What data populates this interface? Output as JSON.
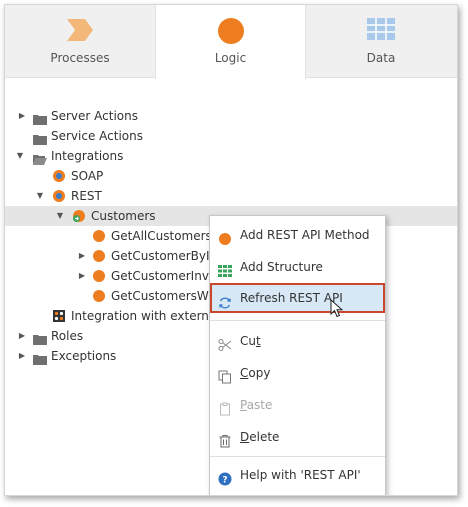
{
  "tabs": [
    {
      "label": "Processes",
      "icon": "processes-chevron-icon"
    },
    {
      "label": "Logic",
      "icon": "logic-circle-icon"
    },
    {
      "label": "Data",
      "icon": "data-grid-icon"
    }
  ],
  "tree": {
    "server_actions": "Server Actions",
    "service_actions": "Service Actions",
    "integrations": "Integrations",
    "soap": "SOAP",
    "rest": "REST",
    "customers": "Customers",
    "method1": "GetAllCustomers",
    "method2": "GetCustomerByI",
    "method3": "GetCustomerInv",
    "method4": "GetCustomersWi",
    "integration_external": "Integration with externa",
    "roles": "Roles",
    "exceptions": "Exceptions"
  },
  "context_menu": {
    "add_method_pre": "Add REST API Method",
    "add_structure_pre": "Add Structure",
    "refresh": "Refresh REST API",
    "cut_u": "t",
    "cut_pre": "Cu",
    "copy_u": "C",
    "copy_post": "opy",
    "paste_u": "P",
    "paste_post": "aste",
    "delete_u": "D",
    "delete_post": "elete",
    "help": "Help with 'REST API'"
  },
  "colors": {
    "accent_orange": "#ee7d1f",
    "highlight_border": "#c8472d",
    "highlight_fill": "#d8e8f7",
    "data_blue": "#5b9bd5"
  }
}
